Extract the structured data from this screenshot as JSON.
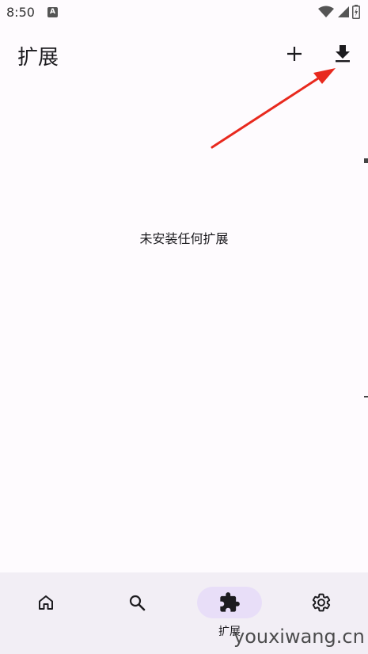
{
  "status_bar": {
    "time": "8:50",
    "notification_icon": "a-letter-icon",
    "icons": [
      "wifi-icon",
      "signal-icon",
      "battery-charging-icon"
    ]
  },
  "app_bar": {
    "title": "扩展",
    "actions": [
      {
        "name": "add-icon",
        "label": "+"
      },
      {
        "name": "download-icon"
      }
    ]
  },
  "empty_state": {
    "message": "未安装任何扩展"
  },
  "bottom_nav": {
    "items": [
      {
        "name": "home-icon",
        "label": ""
      },
      {
        "name": "search-icon",
        "label": ""
      },
      {
        "name": "extension-icon",
        "label": "扩展",
        "active": true
      },
      {
        "name": "settings-icon",
        "label": ""
      }
    ]
  },
  "watermark": "youxiwang.cn",
  "colors": {
    "background": "#fefbfe",
    "nav_background": "#f2eef5",
    "active_indicator": "#e8def8",
    "arrow": "#e8291e",
    "text": "#1c1b1f"
  }
}
